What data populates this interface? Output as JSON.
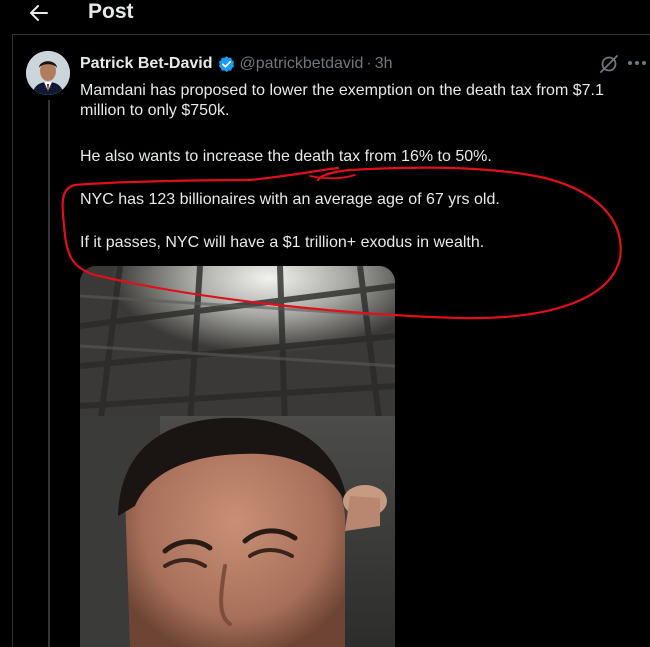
{
  "header": {
    "title": "Post",
    "back_icon": "arrow-left-icon"
  },
  "tweet": {
    "author_name": "Patrick Bet-David",
    "handle": "@patrickbetdavid",
    "separator": "·",
    "time": "3h",
    "verified": true,
    "verified_color": "#1d9bf0",
    "paragraphs": [
      "Mamdani has proposed to lower the exemption on the death tax from $7.1 million to only $750k.",
      "He also wants to increase the death tax from 16% to 50%.",
      "NYC has 123 billionaires with an average age of 67 yrs old.",
      "If it passes, NYC will have a $1 trillion+ exodus in wealth."
    ],
    "media": {
      "type": "video"
    }
  },
  "annotation": {
    "color": "#e0101a",
    "kind": "hand-drawn circle and underline"
  },
  "icons": {
    "grok": "grok-icon",
    "more": "more-dots-icon",
    "verified": "verified-badge-icon"
  }
}
